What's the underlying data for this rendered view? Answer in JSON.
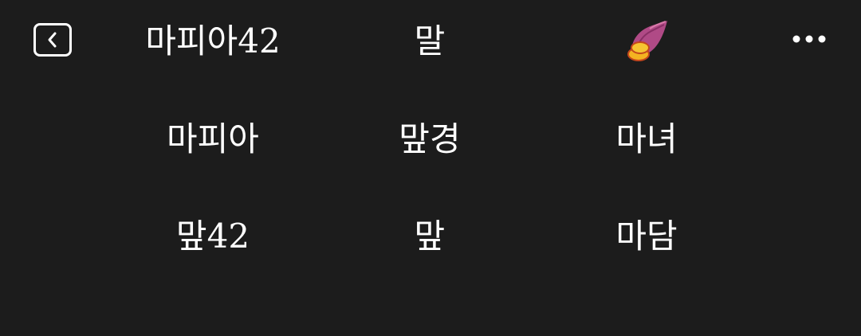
{
  "header": {
    "back_icon": "chevron-left-icon",
    "more_icon": "more-dots-icon",
    "title_left": "마피아42",
    "title_center": "말",
    "title_emoji": "sweet-potato-icon"
  },
  "grid": {
    "rows": [
      [
        "마피아",
        "맢경",
        "마녀"
      ],
      [
        "맢42",
        "맢",
        "마담"
      ]
    ]
  },
  "colors": {
    "background": "#1c1c1c",
    "text": "#ffffff"
  }
}
